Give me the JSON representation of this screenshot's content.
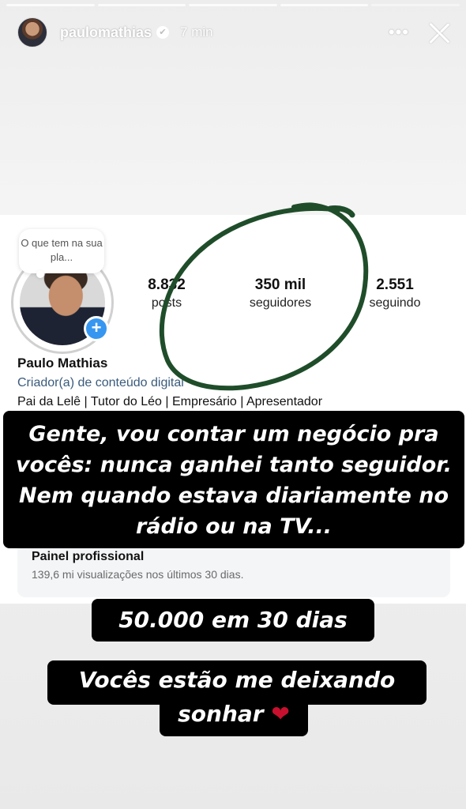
{
  "story": {
    "progress_segments": 5,
    "current_segment": 5,
    "username": "paulomathias",
    "time_ago": "7 min",
    "icons": {
      "verified": "verified-badge-icon",
      "more": "more-icon",
      "close": "close-icon"
    }
  },
  "profile": {
    "note": "O que tem na sua pla...",
    "stats": {
      "posts_value": "8.832",
      "posts_label": "posts",
      "followers_value": "350 mil",
      "followers_label": "seguidores",
      "following_value": "2.551",
      "following_label": "seguindo"
    },
    "name": "Paulo Mathias",
    "category": "Criador(a) de conteúdo digital",
    "bio": "Pai da Lelê | Tutor do Léo | Empresário | Apresentador",
    "dashboard": {
      "title": "Painel profissional",
      "subtitle": "139,6 mi visualizações nos últimos 30 dias."
    }
  },
  "captions": {
    "line1": "Gente, vou contar um negócio pra vocês: nunca ganhei tanto seguidor. Nem quando estava diariamente no rádio ou na TV...",
    "line2": "50.000 em 30 dias",
    "line3": "Vocês estão me deixando",
    "line4": "sonhar",
    "heart": "❤"
  },
  "colors": {
    "accent_blue": "#3797f0",
    "circle_stroke": "#1f4d2a",
    "caption_bg": "#000000",
    "heart": "#c8102e"
  }
}
